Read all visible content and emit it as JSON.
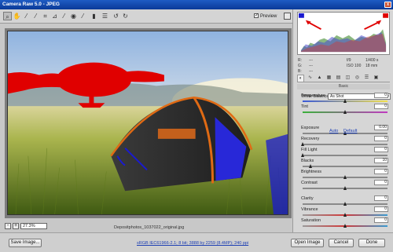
{
  "window": {
    "title": "Camera Raw 5.0  -  JPEG",
    "close_label": "x"
  },
  "toolbar": {
    "tools": [
      {
        "icon": "zoom-icon",
        "glyph": "⌕"
      },
      {
        "icon": "hand-icon",
        "glyph": "✋"
      },
      {
        "icon": "white-balance-icon",
        "glyph": "⁄"
      },
      {
        "icon": "color-sampler-icon",
        "glyph": "⁄"
      },
      {
        "icon": "crop-icon",
        "glyph": "⌗"
      },
      {
        "icon": "straighten-icon",
        "glyph": "⊿"
      },
      {
        "icon": "retouch-icon",
        "glyph": "⁄"
      },
      {
        "icon": "red-eye-icon",
        "glyph": "◉"
      },
      {
        "icon": "adjustment-brush-icon",
        "glyph": "⁄"
      },
      {
        "icon": "graduated-filter-icon",
        "glyph": "▮"
      },
      {
        "icon": "preferences-icon",
        "glyph": "☰"
      },
      {
        "icon": "rotate-ccw-icon",
        "glyph": "↺"
      },
      {
        "icon": "rotate-cw-icon",
        "glyph": "↻"
      }
    ],
    "preview_label": "Preview"
  },
  "zoom": {
    "value": "27.3%",
    "minus": "-",
    "plus": "+"
  },
  "filename": "Depositphotos_1037022_original.jpg",
  "footer": {
    "save_label": "Save Image...",
    "workflow_text": "sRGB IEC61966-2.1; 8 bit; 3888 by 2259 (8.4MP); 240 ppi",
    "open_label": "Open Image",
    "cancel_label": "Cancel",
    "done_label": "Done"
  },
  "info": {
    "r": "R:",
    "g": "G:",
    "b": "B:",
    "dashes": "---",
    "fstop": "f/9",
    "shutter": "1/400 s",
    "iso": "ISO 100",
    "focal": "18 mm"
  },
  "panel": {
    "tab_icons": [
      "basic-tab-icon",
      "tone-curve-tab-icon",
      "detail-tab-icon",
      "hsl-tab-icon",
      "split-toning-tab-icon",
      "lens-tab-icon",
      "camera-calibration-tab-icon",
      "presets-tab-icon",
      "snapshots-tab-icon"
    ],
    "section_title": "Basic",
    "white_balance_label": "White Balance:",
    "white_balance_value": "As Shot",
    "auto_label": "Auto",
    "default_label": "Default",
    "sliders": [
      {
        "name": "temperature",
        "label": "Temperature",
        "value": "0",
        "level": 0.5
      },
      {
        "name": "tint",
        "label": "Tint",
        "value": "0",
        "level": 0.5
      },
      {
        "name": "exposure",
        "label": "Exposure",
        "value": "0.00",
        "level": 0.5
      },
      {
        "name": "recovery",
        "label": "Recovery",
        "value": "0",
        "level": 0.0
      },
      {
        "name": "fill-light",
        "label": "Fill Light",
        "value": "0",
        "level": 0.0
      },
      {
        "name": "blacks",
        "label": "Blacks",
        "value": "10",
        "level": 0.1
      },
      {
        "name": "brightness",
        "label": "Brightness",
        "value": "0",
        "level": 0.5
      },
      {
        "name": "contrast",
        "label": "Contrast",
        "value": "0",
        "level": 0.5
      },
      {
        "name": "clarity",
        "label": "Clarity",
        "value": "0",
        "level": 0.5
      },
      {
        "name": "vibrance",
        "label": "Vibrance",
        "value": "0",
        "level": 0.5
      },
      {
        "name": "saturation",
        "label": "Saturation",
        "value": "0",
        "level": 0.5
      }
    ]
  },
  "colors": {
    "titlebar": "#0a3a98",
    "clipping_highlight": "#e00000",
    "clipping_shadow": "#1010d0",
    "annotation_arrow": "#e00000"
  }
}
